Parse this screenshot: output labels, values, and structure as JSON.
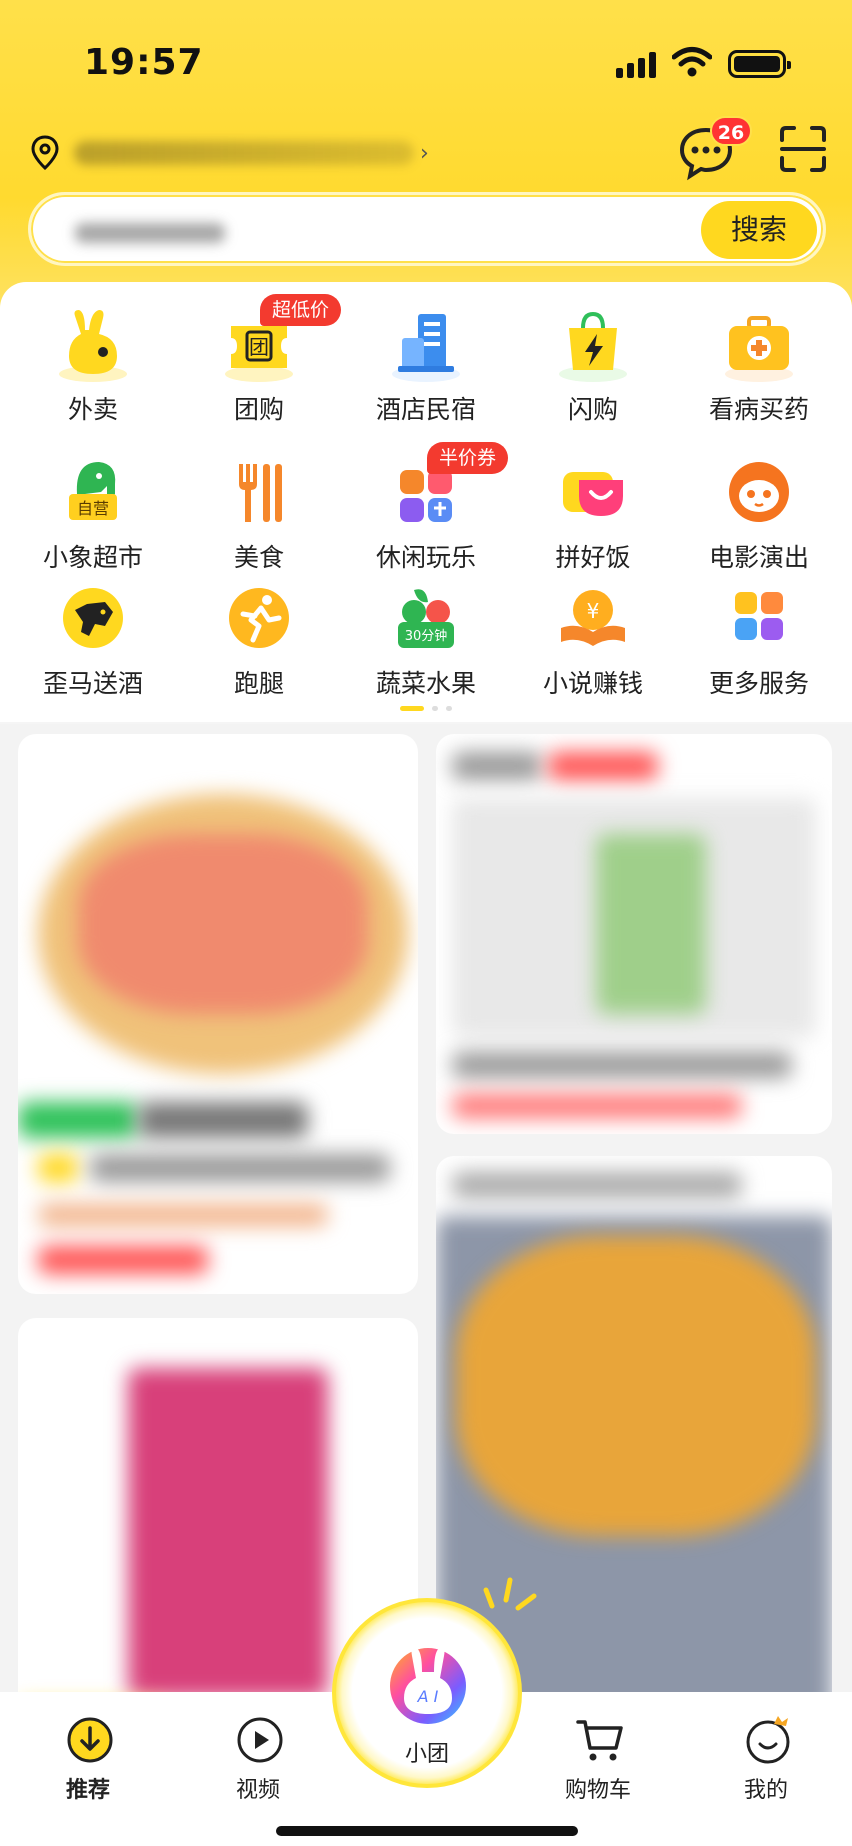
{
  "status_bar": {
    "time": "19:57"
  },
  "header": {
    "message_badge": "26",
    "search_button_label": "搜索"
  },
  "categories": [
    {
      "label": "外卖",
      "icon": "takeout-bunny-icon"
    },
    {
      "label": "团购",
      "icon": "group-buy-ticket-icon",
      "tag": "超低价"
    },
    {
      "label": "酒店民宿",
      "icon": "hotel-building-icon"
    },
    {
      "label": "闪购",
      "icon": "flash-bag-icon"
    },
    {
      "label": "看病买药",
      "icon": "medkit-icon"
    },
    {
      "label": "小象超市",
      "icon": "elephant-market-icon",
      "sub_badge": "自营"
    },
    {
      "label": "美食",
      "icon": "fork-knife-icon"
    },
    {
      "label": "休闲玩乐",
      "icon": "leisure-icon",
      "tag": "半价券"
    },
    {
      "label": "拼好饭",
      "icon": "pinhaofan-icon"
    },
    {
      "label": "电影演出",
      "icon": "movie-cat-icon"
    },
    {
      "label": "歪马送酒",
      "icon": "waima-horse-icon"
    },
    {
      "label": "跑腿",
      "icon": "errand-runner-icon"
    },
    {
      "label": "蔬菜水果",
      "icon": "vegetable-fruit-icon",
      "sub_badge": "30分钟"
    },
    {
      "label": "小说赚钱",
      "icon": "novel-coin-icon",
      "coin_glyph": "¥"
    },
    {
      "label": "更多服务",
      "icon": "more-services-icon"
    }
  ],
  "tabbar": {
    "items": [
      {
        "label": "推荐",
        "icon": "recommend-down-arrow-icon",
        "active": true
      },
      {
        "label": "视频",
        "icon": "video-play-icon",
        "active": false
      },
      {
        "label": "小团",
        "icon": "xiaotuan-bunny-icon",
        "active": false
      },
      {
        "label": "购物车",
        "icon": "shopping-cart-icon",
        "active": false
      },
      {
        "label": "我的",
        "icon": "profile-smile-icon",
        "active": false
      }
    ]
  },
  "colors": {
    "brand_yellow": "#ffd81f",
    "tag_red": "#f33a2f",
    "badge_red": "#ff3333"
  }
}
